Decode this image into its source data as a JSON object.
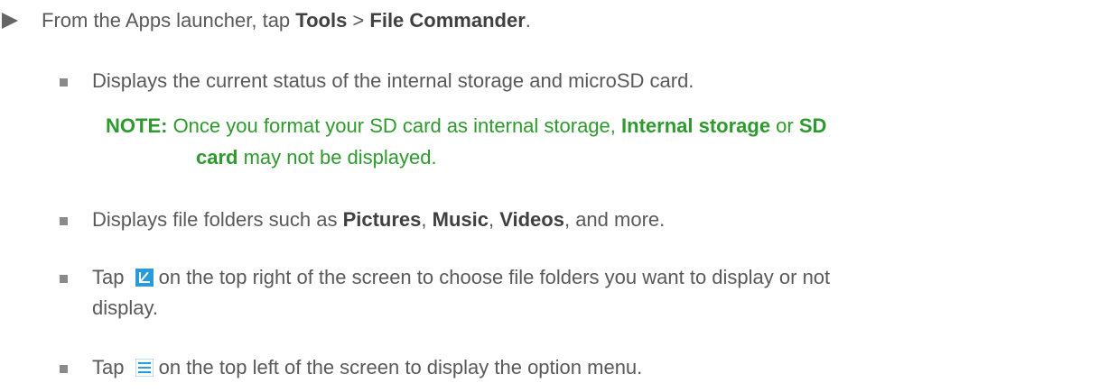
{
  "step": {
    "prefix": "From the Apps launcher, tap ",
    "tools": "Tools",
    "sep": " > ",
    "app": "File Commander",
    "end": "."
  },
  "bullets": {
    "b1": "Displays the current status of the internal storage and microSD card.",
    "b2": {
      "prefix": "Displays file folders such as ",
      "pictures": "Pictures",
      "c1": ", ",
      "music": "Music",
      "c2": ", ",
      "videos": "Videos",
      "end": ", and more."
    },
    "b3": {
      "prefix": "Tap ",
      "line1": "on the top right of the screen to choose file folders you want to display or not",
      "line2": "display."
    },
    "b4": {
      "prefix": "Tap ",
      "text": "on the top left of the screen to display the option menu."
    }
  },
  "note": {
    "label": "NOTE:",
    "t1": " Once you format your SD card as internal storage, ",
    "internal": "Internal storage",
    "or": " or ",
    "sd1": "SD",
    "sd2": "card",
    "t2": " may not be displayed."
  },
  "icons": {
    "step_arrow": "triangle-right-icon",
    "edit": "edit-folders-icon",
    "menu": "hamburger-menu-icon"
  },
  "colors": {
    "body_text": "#595959",
    "note_green": "#2e9a2e",
    "icon_blue": "#2a9bd6"
  }
}
